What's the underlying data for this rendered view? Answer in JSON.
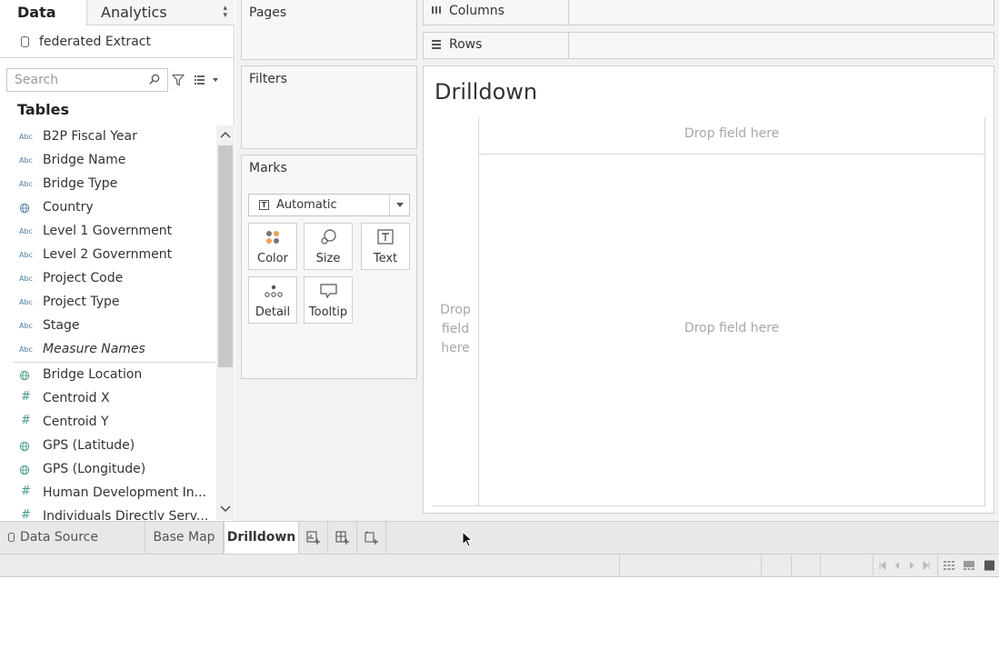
{
  "data_pane": {
    "tab_data": "Data",
    "tab_analytics": "Analytics",
    "datasource": "federated Extract",
    "search_placeholder": "Search",
    "tables_title": "Tables",
    "dimensions": [
      {
        "type": "Abc",
        "label": "B2P Fiscal Year"
      },
      {
        "type": "Abc",
        "label": "Bridge Name"
      },
      {
        "type": "Abc",
        "label": "Bridge Type"
      },
      {
        "type": "globe",
        "label": "Country"
      },
      {
        "type": "Abc",
        "label": "Level 1 Government"
      },
      {
        "type": "Abc",
        "label": "Level 2 Government"
      },
      {
        "type": "Abc",
        "label": "Project Code"
      },
      {
        "type": "Abc",
        "label": "Project Type"
      },
      {
        "type": "Abc",
        "label": "Stage"
      },
      {
        "type": "Abc",
        "label": "Measure Names"
      }
    ],
    "measures": [
      {
        "type": "globe",
        "label": "Bridge Location"
      },
      {
        "type": "#",
        "label": "Centroid X"
      },
      {
        "type": "#",
        "label": "Centroid Y"
      },
      {
        "type": "globe",
        "label": "GPS (Latitude)"
      },
      {
        "type": "globe",
        "label": "GPS (Longitude)"
      },
      {
        "type": "#",
        "label": "Human Development In..."
      },
      {
        "type": "#",
        "label": "Individuals Directly Serv..."
      }
    ]
  },
  "cards": {
    "pages": "Pages",
    "filters": "Filters",
    "marks": "Marks",
    "marks_type": "Automatic",
    "mark_buttons": {
      "color": "Color",
      "size": "Size",
      "text": "Text",
      "detail": "Detail",
      "tooltip": "Tooltip"
    }
  },
  "shelves": {
    "columns": "Columns",
    "rows": "Rows"
  },
  "viz": {
    "title": "Drilldown",
    "drop_top": "Drop field here",
    "drop_left": "Drop field here",
    "drop_center": "Drop field here"
  },
  "sheet_tabs": {
    "data_source": "Data Source",
    "base_map": "Base Map",
    "drilldown": "Drilldown"
  },
  "colors": {
    "accent_blue": "#4e7ea3",
    "measure_green": "#4a9a8d",
    "color_dot_orange": "#f0a15a",
    "color_dot_gray": "#777777"
  }
}
